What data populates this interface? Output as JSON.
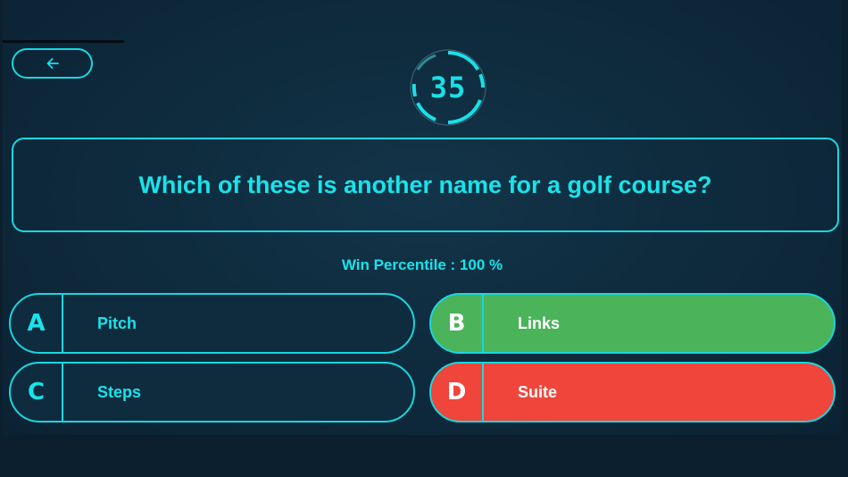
{
  "icons": {
    "back": "arrow-left-icon"
  },
  "timer": {
    "value": "35"
  },
  "question": {
    "text": "Which of these is another name for a golf course?"
  },
  "stats": {
    "win_percentile": "Win Percentile : 100 %"
  },
  "answers": [
    {
      "letter": "A",
      "text": "Pitch",
      "state": "neutral"
    },
    {
      "letter": "B",
      "text": "Links",
      "state": "correct"
    },
    {
      "letter": "C",
      "text": "Steps",
      "state": "neutral"
    },
    {
      "letter": "D",
      "text": "Suite",
      "state": "wrong"
    }
  ],
  "colors": {
    "accent": "#19d7e0",
    "background": "#0e2a3c",
    "correct": "#4bb35a",
    "wrong": "#f0453a"
  }
}
